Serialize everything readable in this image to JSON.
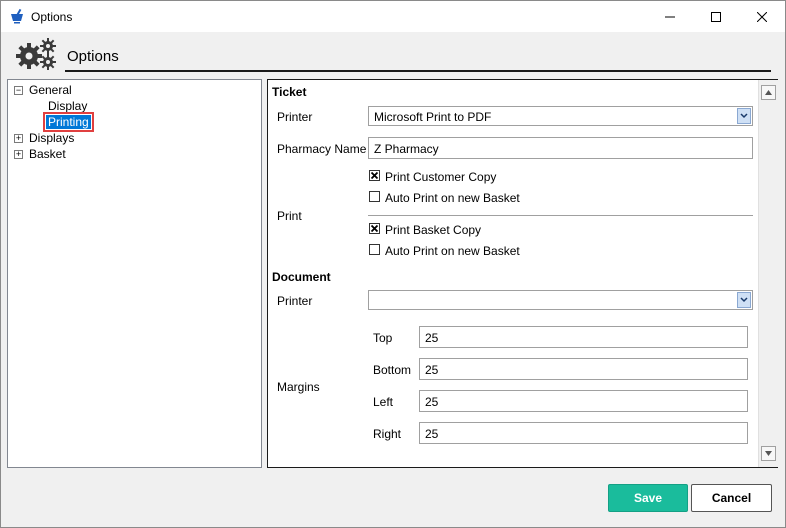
{
  "window": {
    "title": "Options"
  },
  "header": {
    "title": "Options"
  },
  "tree": {
    "items": [
      {
        "label": "General",
        "expander": "−"
      },
      {
        "label": "Display"
      },
      {
        "label": "Printing"
      },
      {
        "label": "Displays",
        "expander": "+"
      },
      {
        "label": "Basket",
        "expander": "+"
      }
    ]
  },
  "ticket": {
    "section_title": "Ticket",
    "printer_label": "Printer",
    "printer_value": "Microsoft Print to PDF",
    "pharmacy_name_label": "Pharmacy Name",
    "pharmacy_name_value": "Z Pharmacy",
    "print_label": "Print",
    "print_customer_copy": {
      "label": "Print Customer Copy",
      "checked": true
    },
    "auto_print_1": {
      "label": "Auto Print on new Basket",
      "checked": false
    },
    "print_basket_copy": {
      "label": "Print Basket Copy",
      "checked": true
    },
    "auto_print_2": {
      "label": "Auto Print on new Basket",
      "checked": false
    }
  },
  "document": {
    "section_title": "Document",
    "printer_label": "Printer",
    "printer_value": "",
    "margins_label": "Margins",
    "top_label": "Top",
    "top_value": "25",
    "bottom_label": "Bottom",
    "bottom_value": "25",
    "left_label": "Left",
    "left_value": "25",
    "right_label": "Right",
    "right_value": "25"
  },
  "footer": {
    "save_label": "Save",
    "cancel_label": "Cancel"
  },
  "colors": {
    "accent": "#1abc9c",
    "selection": "#0078d7",
    "highlight_outline": "#e04040"
  }
}
